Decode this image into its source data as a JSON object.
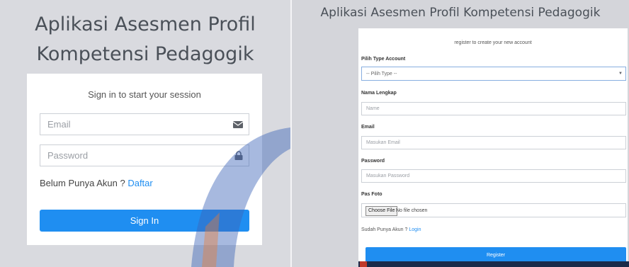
{
  "signin": {
    "title_line1": "Aplikasi Asesmen Profil",
    "title_line2": "Kompetensi Pedagogik",
    "subtitle": "Sign in to start your session",
    "email_placeholder": "Email",
    "password_placeholder": "Password",
    "no_account_text": "Belum Punya Akun ?",
    "register_link": "Daftar",
    "signin_button": "Sign In"
  },
  "register": {
    "title": "Aplikasi Asesmen Profil Kompetensi Pedagogik",
    "subtitle": "register to create your new account",
    "type_label": "Pilih Type Account",
    "type_selected": "-- Pilih Type --",
    "name_label": "Nama Lengkap",
    "name_placeholder": "Name",
    "email_label": "Email",
    "email_placeholder": "Masukan Email",
    "password_label": "Password",
    "password_placeholder": "Masukan Password",
    "photo_label": "Pas Foto",
    "choose_file_button": "Choose File",
    "no_file_text": "No file chosen",
    "have_account_text": "Sudah Punya Akun ?",
    "login_link": "Login",
    "register_button": "Register"
  },
  "colors": {
    "accent": "#1f8ef1",
    "watermark_blue": "#3b63b8",
    "watermark_orange": "#f07a2c"
  },
  "icons": [
    "envelope-icon",
    "lock-icon",
    "caret-down-icon",
    "watermark-logo"
  ]
}
